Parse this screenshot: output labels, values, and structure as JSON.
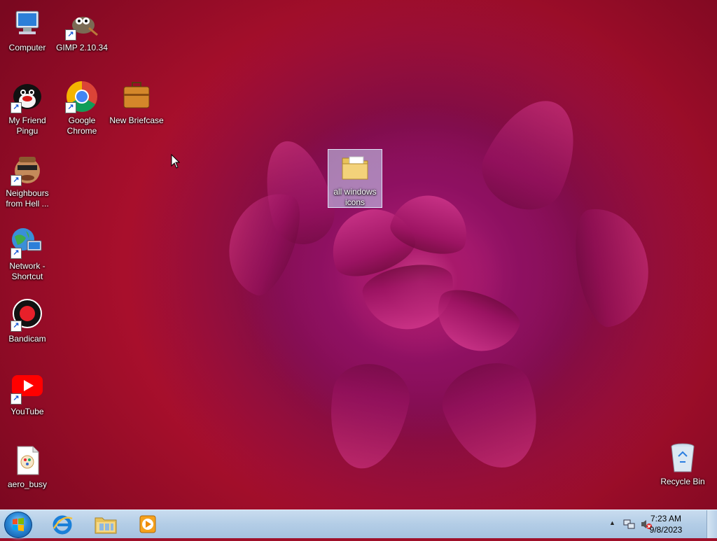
{
  "desktop": {
    "icons": [
      {
        "label": "Computer",
        "icon": "computer-icon"
      },
      {
        "label": "GIMP 2.10.34",
        "icon": "gimp-icon",
        "shortcut": true
      },
      {
        "label": "My Friend Pingu",
        "icon": "pingu-icon",
        "shortcut": true
      },
      {
        "label": "Google Chrome",
        "icon": "chrome-icon",
        "shortcut": true
      },
      {
        "label": "New Briefcase",
        "icon": "briefcase-icon"
      },
      {
        "label": "Neighbours from Hell ...",
        "icon": "neighbours-icon",
        "shortcut": true
      },
      {
        "label": "all windows icons",
        "icon": "folder-icon",
        "selected": true
      },
      {
        "label": "Network - Shortcut",
        "icon": "network-icon",
        "shortcut": true
      },
      {
        "label": "Bandicam",
        "icon": "bandicam-icon",
        "shortcut": true
      },
      {
        "label": "YouTube",
        "icon": "youtube-icon",
        "shortcut": true
      },
      {
        "label": "aero_busy",
        "icon": "aero-busy-file-icon"
      },
      {
        "label": "Recycle Bin",
        "icon": "recycle-bin-icon"
      }
    ]
  },
  "taskbar": {
    "start_icon": "windows-start-icon",
    "pinned": [
      {
        "name": "Internet Explorer",
        "icon": "internet-explorer-icon"
      },
      {
        "name": "Windows Explorer",
        "icon": "file-explorer-icon"
      },
      {
        "name": "Windows Media Player",
        "icon": "media-player-icon"
      }
    ],
    "tray": {
      "chevron": "▲",
      "network_icon": "network-tray-icon",
      "volume_icon": "volume-muted-icon"
    },
    "clock": {
      "time": "7:23 AM",
      "date": "9/8/2023"
    }
  }
}
